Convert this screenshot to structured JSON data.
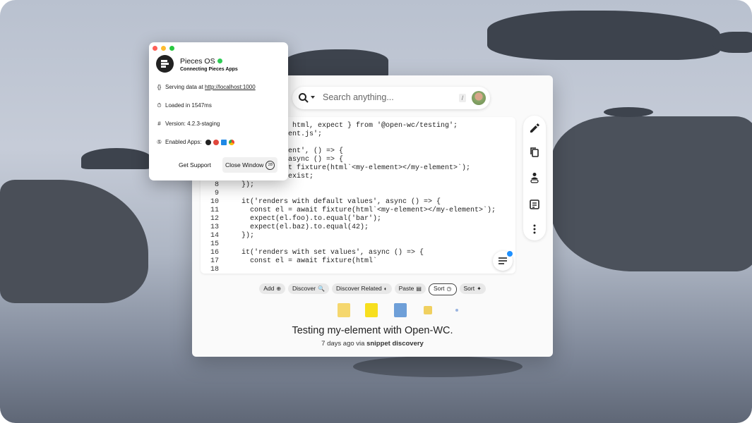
{
  "popup": {
    "app_name": "Pieces OS",
    "subtitle": "Connecting Pieces Apps",
    "serving_prefix": "Serving data at",
    "serving_url": "http://localhost:1000",
    "loaded": "Loaded in 1547ms",
    "version": "Version: 4.2.3-staging",
    "enabled_apps_label": "Enabled Apps:",
    "enabled_apps": [
      "pieces-icon",
      "chrome-extension-icon",
      "vscode-icon",
      "chrome-icon"
    ],
    "get_support": "Get Support",
    "close_window": "Close Window",
    "close_badge": "28",
    "traffic_colors": [
      "#ff5f57",
      "#febc2e",
      "#28c840"
    ]
  },
  "search": {
    "placeholder": "Search anything...",
    "shortcut": "/"
  },
  "code": {
    "lines": [
      {
        "n": "",
        "t": "              html, expect } from '@open-wc/testing';"
      },
      {
        "n": "",
        "t": "           ement.js';"
      },
      {
        "n": "",
        "t": ""
      },
      {
        "n": "",
        "t": "           ement', () => {"
      },
      {
        "n": "",
        "t": "           , async () => {"
      },
      {
        "n": "",
        "t": "           ait fixture(html`<my-element></my-element>`);"
      },
      {
        "n": "",
        "t": "           o.exist;"
      },
      {
        "n": "8",
        "t": "  });"
      },
      {
        "n": "9",
        "t": ""
      },
      {
        "n": "10",
        "t": "  it('renders with default values', async () => {"
      },
      {
        "n": "11",
        "t": "    const el = await fixture(html`<my-element></my-element>`);"
      },
      {
        "n": "12",
        "t": "    expect(el.foo).to.equal('bar');"
      },
      {
        "n": "13",
        "t": "    expect(el.baz).to.equal(42);"
      },
      {
        "n": "14",
        "t": "  });"
      },
      {
        "n": "15",
        "t": ""
      },
      {
        "n": "16",
        "t": "  it('renders with set values', async () => {"
      },
      {
        "n": "17",
        "t": "    const el = await fixture(html`"
      },
      {
        "n": "18",
        "t": ""
      }
    ]
  },
  "sidebar": {
    "icons": [
      "edit-icon",
      "copy-icon",
      "share-link-icon",
      "notes-icon",
      "more-icon"
    ]
  },
  "chips": [
    {
      "label": "Add",
      "glyph": "⊕",
      "outlined": false
    },
    {
      "label": "Discover",
      "glyph": "🔍",
      "outlined": false
    },
    {
      "label": "Discover Related",
      "glyph": "◐",
      "outlined": false
    },
    {
      "label": "Paste",
      "glyph": "▤",
      "outlined": false
    },
    {
      "label": "Sort",
      "glyph": "◷",
      "outlined": true
    },
    {
      "label": "Sort",
      "glyph": "✦",
      "outlined": false
    }
  ],
  "snippet": {
    "title": "Testing my-element with Open-WC.",
    "age": "7 days ago via",
    "source": "snippet discovery"
  }
}
